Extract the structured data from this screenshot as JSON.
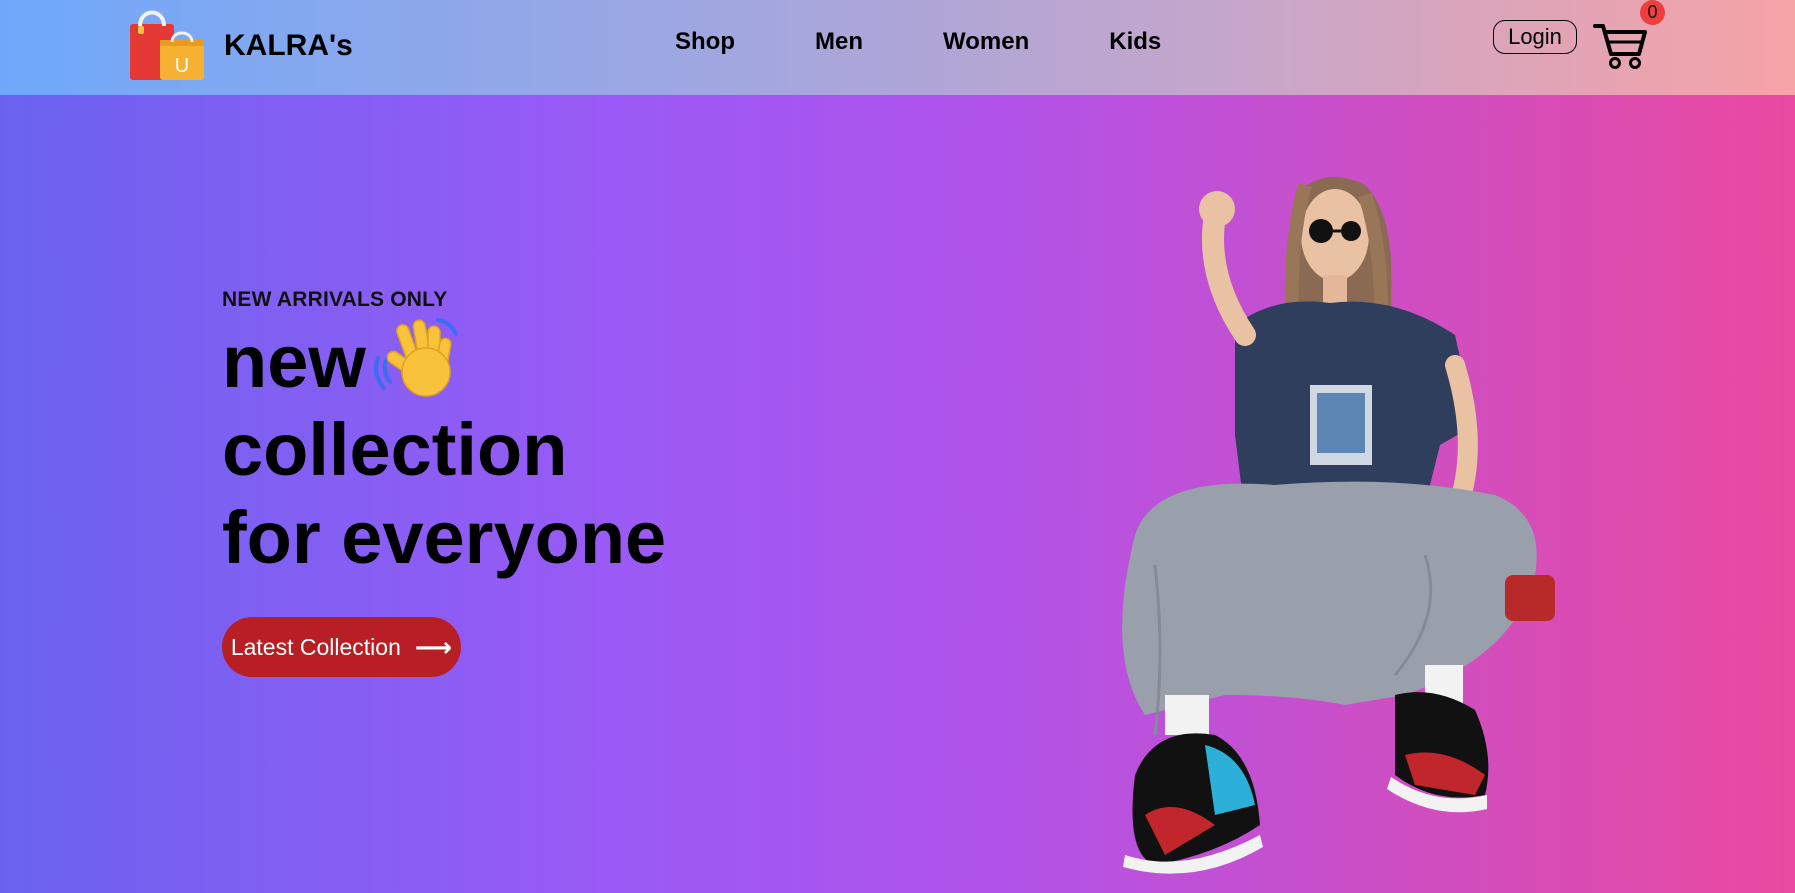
{
  "header": {
    "brand": "KALRA's",
    "logo_icon": "shopping-bag-icon",
    "logo_letter": "U",
    "nav": [
      "Shop",
      "Men",
      "Women",
      "Kids"
    ],
    "login_label": "Login",
    "cart_icon": "cart-icon",
    "cart_count": "0"
  },
  "hero": {
    "tagline": "NEW ARRIVALS ONLY",
    "headline_line1": "new",
    "headline_line2": "collection",
    "headline_line3": "for everyone",
    "wave_icon": "waving-hand-icon",
    "cta_label": "Latest Collection",
    "cta_arrow": "⟶",
    "hero_image": "fashion-model-photo"
  },
  "colors": {
    "cta": "#b81f24",
    "badge": "#ef3e3e"
  }
}
